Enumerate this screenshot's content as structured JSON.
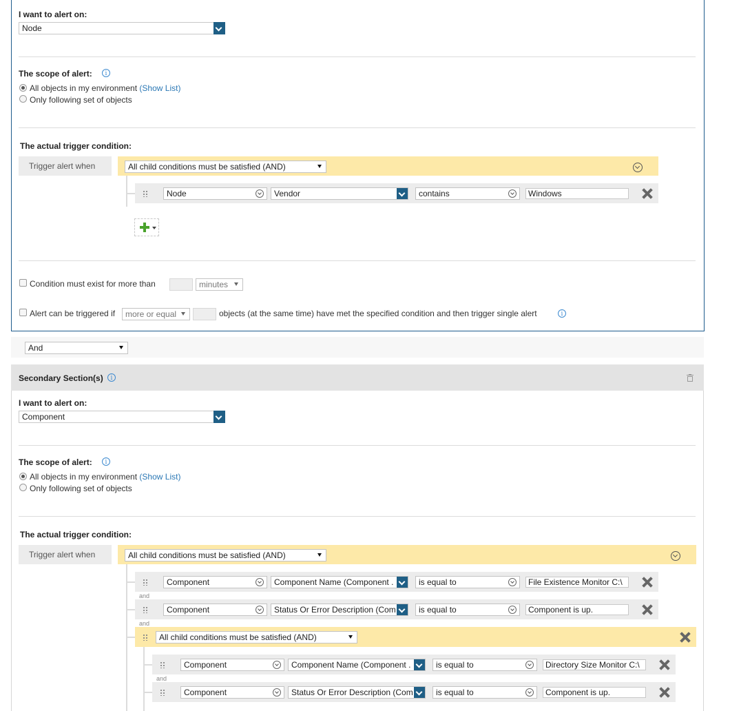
{
  "primary": {
    "alert_on_label": "I want to alert on:",
    "alert_on_value": "Node",
    "scope_label": "The scope of alert:",
    "scope_all": "All objects in my environment",
    "scope_show_list": "(Show List)",
    "scope_only": "Only following set of objects",
    "trigger_label": "The actual trigger condition:",
    "trigger_when": "Trigger alert when",
    "group_select": "All child conditions must be satisfied (AND)",
    "condition": {
      "object": "Node",
      "field": "Vendor",
      "operator": "contains",
      "value": "Windows"
    },
    "exist_text": "Condition must exist for more than",
    "exist_unit": "minutes",
    "alert_if_prefix": "Alert can be triggered if",
    "alert_if_select": "more or equal",
    "alert_if_suffix": "objects (at the same time) have met the specified condition and then trigger single alert"
  },
  "join_select": "And",
  "secondary": {
    "header": "Secondary Section(s)",
    "alert_on_label": "I want to alert on:",
    "alert_on_value": "Component",
    "scope_label": "The scope of alert:",
    "scope_all": "All objects in my environment",
    "scope_show_list": "(Show List)",
    "scope_only": "Only following set of objects",
    "trigger_label": "The actual trigger condition:",
    "trigger_when": "Trigger alert when",
    "group_select": "All child conditions must be satisfied (AND)",
    "and_word": "and",
    "conditions": [
      {
        "object": "Component",
        "field": "Component Name (Component .",
        "operator": "is equal to",
        "value": "File Existence Monitor C:\\"
      },
      {
        "object": "Component",
        "field": "Status Or Error Description (Com",
        "operator": "is equal to",
        "value": "Component is up."
      }
    ],
    "nested_group_select": "All child conditions must be satisfied (AND)",
    "nested_conditions": [
      {
        "object": "Component",
        "field": "Component Name (Component .",
        "operator": "is equal to",
        "value": "Directory Size Monitor C:\\"
      },
      {
        "object": "Component",
        "field": "Status Or Error Description (Com",
        "operator": "is equal to",
        "value": "Component is up."
      }
    ]
  },
  "colors": {
    "accent": "#1f5f86",
    "band": "#fde9a8",
    "link": "#2b78b5",
    "border": "#1c5a8c"
  }
}
